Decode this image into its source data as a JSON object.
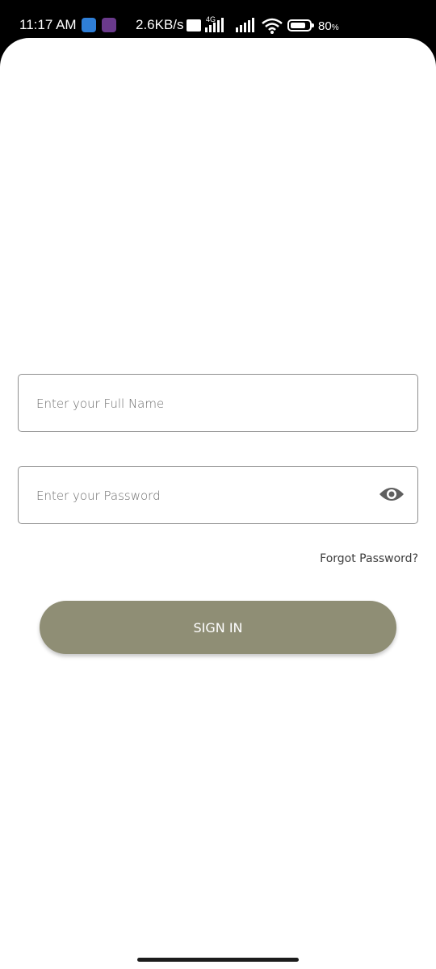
{
  "status_bar": {
    "time": "11:17 AM",
    "net_speed": "2.6KB/s",
    "network_type": "4G",
    "battery_percent": "80",
    "battery_unit": "%",
    "battery_level": 0.8,
    "icons": [
      "app-notification-icon",
      "app-notification-icon",
      "volte-icon",
      "signal-icon",
      "signal-icon",
      "wifi-icon",
      "battery-icon"
    ]
  },
  "form": {
    "name_placeholder": "Enter your Full Name",
    "password_placeholder": "Enter your Password",
    "password_toggle_icon": "eye-icon",
    "forgot_label": "Forgot Password?",
    "sign_in_label": "SIGN IN"
  },
  "colors": {
    "button": "#8f8e75",
    "field_border": "#8f8f8f",
    "background": "#ffffff"
  }
}
